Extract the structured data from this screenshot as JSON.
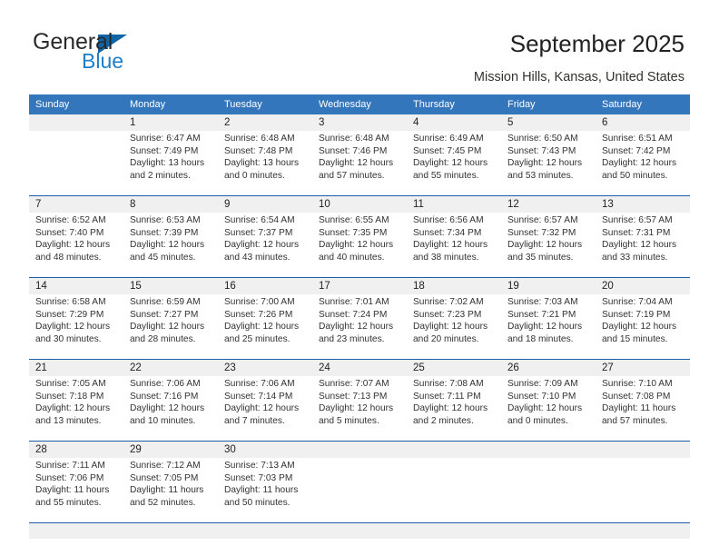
{
  "brand": {
    "name_part1": "General",
    "name_part2": "Blue",
    "accent_color": "#1064a8",
    "accent_color_light": "#1d7ec9"
  },
  "header": {
    "title": "September 2025",
    "subtitle": "Mission Hills, Kansas, United States",
    "header_bg": "#3476bb",
    "rule_color": "#1a5fa3",
    "numberband_bg": "#f0f0f0"
  },
  "calendar": {
    "weekday_headers": [
      "Sunday",
      "Monday",
      "Tuesday",
      "Wednesday",
      "Thursday",
      "Friday",
      "Saturday"
    ],
    "weeks": [
      [
        {
          "day": "",
          "sunrise": "",
          "sunset": "",
          "daylight1": "",
          "daylight2": ""
        },
        {
          "day": "1",
          "sunrise": "Sunrise: 6:47 AM",
          "sunset": "Sunset: 7:49 PM",
          "daylight1": "Daylight: 13 hours",
          "daylight2": "and 2 minutes."
        },
        {
          "day": "2",
          "sunrise": "Sunrise: 6:48 AM",
          "sunset": "Sunset: 7:48 PM",
          "daylight1": "Daylight: 13 hours",
          "daylight2": "and 0 minutes."
        },
        {
          "day": "3",
          "sunrise": "Sunrise: 6:48 AM",
          "sunset": "Sunset: 7:46 PM",
          "daylight1": "Daylight: 12 hours",
          "daylight2": "and 57 minutes."
        },
        {
          "day": "4",
          "sunrise": "Sunrise: 6:49 AM",
          "sunset": "Sunset: 7:45 PM",
          "daylight1": "Daylight: 12 hours",
          "daylight2": "and 55 minutes."
        },
        {
          "day": "5",
          "sunrise": "Sunrise: 6:50 AM",
          "sunset": "Sunset: 7:43 PM",
          "daylight1": "Daylight: 12 hours",
          "daylight2": "and 53 minutes."
        },
        {
          "day": "6",
          "sunrise": "Sunrise: 6:51 AM",
          "sunset": "Sunset: 7:42 PM",
          "daylight1": "Daylight: 12 hours",
          "daylight2": "and 50 minutes."
        }
      ],
      [
        {
          "day": "7",
          "sunrise": "Sunrise: 6:52 AM",
          "sunset": "Sunset: 7:40 PM",
          "daylight1": "Daylight: 12 hours",
          "daylight2": "and 48 minutes."
        },
        {
          "day": "8",
          "sunrise": "Sunrise: 6:53 AM",
          "sunset": "Sunset: 7:39 PM",
          "daylight1": "Daylight: 12 hours",
          "daylight2": "and 45 minutes."
        },
        {
          "day": "9",
          "sunrise": "Sunrise: 6:54 AM",
          "sunset": "Sunset: 7:37 PM",
          "daylight1": "Daylight: 12 hours",
          "daylight2": "and 43 minutes."
        },
        {
          "day": "10",
          "sunrise": "Sunrise: 6:55 AM",
          "sunset": "Sunset: 7:35 PM",
          "daylight1": "Daylight: 12 hours",
          "daylight2": "and 40 minutes."
        },
        {
          "day": "11",
          "sunrise": "Sunrise: 6:56 AM",
          "sunset": "Sunset: 7:34 PM",
          "daylight1": "Daylight: 12 hours",
          "daylight2": "and 38 minutes."
        },
        {
          "day": "12",
          "sunrise": "Sunrise: 6:57 AM",
          "sunset": "Sunset: 7:32 PM",
          "daylight1": "Daylight: 12 hours",
          "daylight2": "and 35 minutes."
        },
        {
          "day": "13",
          "sunrise": "Sunrise: 6:57 AM",
          "sunset": "Sunset: 7:31 PM",
          "daylight1": "Daylight: 12 hours",
          "daylight2": "and 33 minutes."
        }
      ],
      [
        {
          "day": "14",
          "sunrise": "Sunrise: 6:58 AM",
          "sunset": "Sunset: 7:29 PM",
          "daylight1": "Daylight: 12 hours",
          "daylight2": "and 30 minutes."
        },
        {
          "day": "15",
          "sunrise": "Sunrise: 6:59 AM",
          "sunset": "Sunset: 7:27 PM",
          "daylight1": "Daylight: 12 hours",
          "daylight2": "and 28 minutes."
        },
        {
          "day": "16",
          "sunrise": "Sunrise: 7:00 AM",
          "sunset": "Sunset: 7:26 PM",
          "daylight1": "Daylight: 12 hours",
          "daylight2": "and 25 minutes."
        },
        {
          "day": "17",
          "sunrise": "Sunrise: 7:01 AM",
          "sunset": "Sunset: 7:24 PM",
          "daylight1": "Daylight: 12 hours",
          "daylight2": "and 23 minutes."
        },
        {
          "day": "18",
          "sunrise": "Sunrise: 7:02 AM",
          "sunset": "Sunset: 7:23 PM",
          "daylight1": "Daylight: 12 hours",
          "daylight2": "and 20 minutes."
        },
        {
          "day": "19",
          "sunrise": "Sunrise: 7:03 AM",
          "sunset": "Sunset: 7:21 PM",
          "daylight1": "Daylight: 12 hours",
          "daylight2": "and 18 minutes."
        },
        {
          "day": "20",
          "sunrise": "Sunrise: 7:04 AM",
          "sunset": "Sunset: 7:19 PM",
          "daylight1": "Daylight: 12 hours",
          "daylight2": "and 15 minutes."
        }
      ],
      [
        {
          "day": "21",
          "sunrise": "Sunrise: 7:05 AM",
          "sunset": "Sunset: 7:18 PM",
          "daylight1": "Daylight: 12 hours",
          "daylight2": "and 13 minutes."
        },
        {
          "day": "22",
          "sunrise": "Sunrise: 7:06 AM",
          "sunset": "Sunset: 7:16 PM",
          "daylight1": "Daylight: 12 hours",
          "daylight2": "and 10 minutes."
        },
        {
          "day": "23",
          "sunrise": "Sunrise: 7:06 AM",
          "sunset": "Sunset: 7:14 PM",
          "daylight1": "Daylight: 12 hours",
          "daylight2": "and 7 minutes."
        },
        {
          "day": "24",
          "sunrise": "Sunrise: 7:07 AM",
          "sunset": "Sunset: 7:13 PM",
          "daylight1": "Daylight: 12 hours",
          "daylight2": "and 5 minutes."
        },
        {
          "day": "25",
          "sunrise": "Sunrise: 7:08 AM",
          "sunset": "Sunset: 7:11 PM",
          "daylight1": "Daylight: 12 hours",
          "daylight2": "and 2 minutes."
        },
        {
          "day": "26",
          "sunrise": "Sunrise: 7:09 AM",
          "sunset": "Sunset: 7:10 PM",
          "daylight1": "Daylight: 12 hours",
          "daylight2": "and 0 minutes."
        },
        {
          "day": "27",
          "sunrise": "Sunrise: 7:10 AM",
          "sunset": "Sunset: 7:08 PM",
          "daylight1": "Daylight: 11 hours",
          "daylight2": "and 57 minutes."
        }
      ],
      [
        {
          "day": "28",
          "sunrise": "Sunrise: 7:11 AM",
          "sunset": "Sunset: 7:06 PM",
          "daylight1": "Daylight: 11 hours",
          "daylight2": "and 55 minutes."
        },
        {
          "day": "29",
          "sunrise": "Sunrise: 7:12 AM",
          "sunset": "Sunset: 7:05 PM",
          "daylight1": "Daylight: 11 hours",
          "daylight2": "and 52 minutes."
        },
        {
          "day": "30",
          "sunrise": "Sunrise: 7:13 AM",
          "sunset": "Sunset: 7:03 PM",
          "daylight1": "Daylight: 11 hours",
          "daylight2": "and 50 minutes."
        },
        {
          "day": "",
          "sunrise": "",
          "sunset": "",
          "daylight1": "",
          "daylight2": ""
        },
        {
          "day": "",
          "sunrise": "",
          "sunset": "",
          "daylight1": "",
          "daylight2": ""
        },
        {
          "day": "",
          "sunrise": "",
          "sunset": "",
          "daylight1": "",
          "daylight2": ""
        },
        {
          "day": "",
          "sunrise": "",
          "sunset": "",
          "daylight1": "",
          "daylight2": ""
        }
      ]
    ]
  }
}
